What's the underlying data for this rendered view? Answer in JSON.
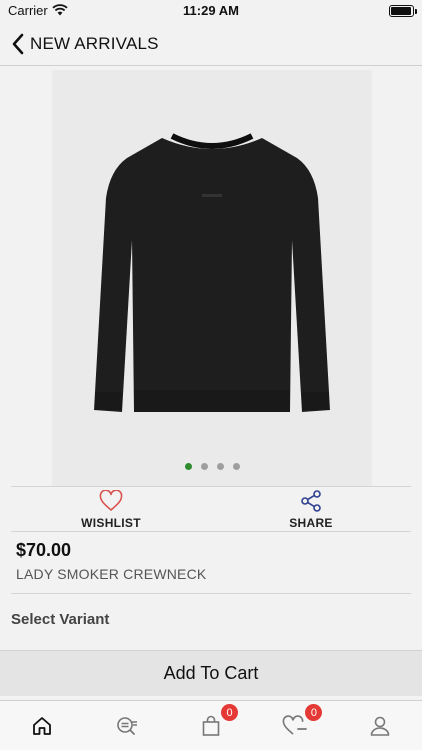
{
  "status_bar": {
    "carrier": "Carrier",
    "time": "11:29 AM",
    "battery_level": 0.95
  },
  "nav": {
    "back_label": "NEW ARRIVALS"
  },
  "gallery": {
    "image_count": 4,
    "active_index": 0,
    "image_alt": "Black crewneck sweatshirt"
  },
  "actions": {
    "wishlist_label": "WISHLIST",
    "share_label": "SHARE"
  },
  "product": {
    "price": "$70.00",
    "name": "LADY SMOKER CREWNECK"
  },
  "variant": {
    "title": "Select Variant"
  },
  "cart_button": {
    "label": "Add To Cart"
  },
  "tab_bar": {
    "items": [
      {
        "name": "home",
        "icon": "home-icon",
        "active": true
      },
      {
        "name": "search",
        "icon": "search-list-icon"
      },
      {
        "name": "cart",
        "icon": "shopping-bag-icon",
        "badge": "0"
      },
      {
        "name": "wishlist",
        "icon": "heart-minus-icon",
        "badge": "0"
      },
      {
        "name": "profile",
        "icon": "user-icon"
      }
    ]
  },
  "colors": {
    "accent_heart": "#d9534f",
    "accent_share": "#2f3f8f",
    "badge": "#e53935",
    "active_dot": "#2e8b2e"
  }
}
